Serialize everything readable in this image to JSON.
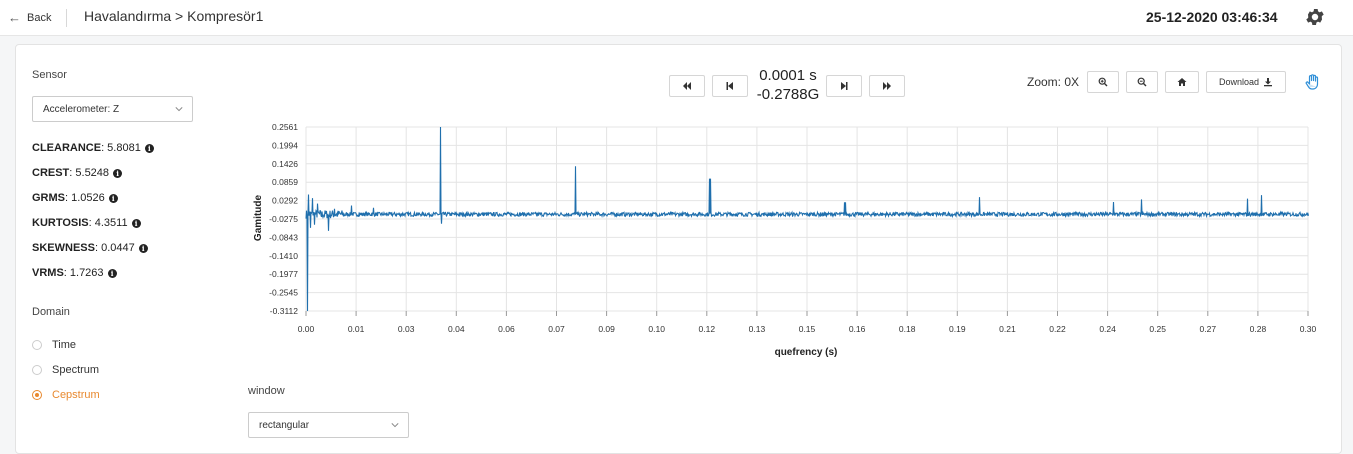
{
  "header": {
    "back_label": "Back",
    "breadcrumb": "Havalandırma > Kompresör1",
    "datetime": "25-12-2020 03:46:34"
  },
  "sidebar": {
    "sensor_label": "Sensor",
    "sensor_value": "Accelerometer: Z",
    "metrics": [
      {
        "name": "CLEARANCE",
        "value": ": 5.8081"
      },
      {
        "name": "CREST",
        "value": ": 5.5248"
      },
      {
        "name": "GRMS",
        "value": ": 1.0526"
      },
      {
        "name": "KURTOSIS",
        "value": ": 4.3511"
      },
      {
        "name": "SKEWNESS",
        "value": ": 0.0447"
      },
      {
        "name": "VRMS",
        "value": ": 1.7263"
      }
    ],
    "domain_label": "Domain",
    "domains": [
      {
        "label": "Time",
        "selected": false
      },
      {
        "label": "Spectrum",
        "selected": false
      },
      {
        "label": "Cepstrum",
        "selected": true
      }
    ]
  },
  "controls": {
    "readout_time": "0.0001 s",
    "readout_value": "-0.2788G",
    "zoom_label": "Zoom: 0X",
    "download_label": "Download"
  },
  "window_select": {
    "label": "window",
    "value": "rectangular"
  },
  "colors": {
    "accent": "#e8892f",
    "series": "#1f6fad",
    "hand_icon": "#2f8fd8"
  },
  "chart_data": {
    "type": "line",
    "xlabel": "quefrency (s)",
    "ylabel": "Gamitude",
    "xlim": [
      0,
      0.3
    ],
    "ylim": [
      -0.3112,
      0.2561
    ],
    "x_ticks": [
      "0.00",
      "0.01",
      "0.03",
      "0.04",
      "0.06",
      "0.07",
      "0.09",
      "0.10",
      "0.12",
      "0.13",
      "0.15",
      "0.16",
      "0.18",
      "0.19",
      "0.21",
      "0.22",
      "0.24",
      "0.25",
      "0.27",
      "0.28",
      "0.30"
    ],
    "y_ticks": [
      "0.2561",
      "0.1994",
      "0.1426",
      "0.0859",
      "0.0292",
      "-0.0275",
      "-0.0843",
      "-0.1410",
      "-0.1977",
      "-0.2545",
      "-0.3112"
    ],
    "grid": true,
    "baseline": -0.013,
    "noise_amplitude": 0.006,
    "peaks": [
      {
        "x": 0.0004,
        "y": -0.3112
      },
      {
        "x": 0.0006,
        "y": 0.048
      },
      {
        "x": 0.0012,
        "y": -0.055
      },
      {
        "x": 0.0018,
        "y": 0.037
      },
      {
        "x": 0.0025,
        "y": -0.045
      },
      {
        "x": 0.0033,
        "y": 0.02
      },
      {
        "x": 0.0045,
        "y": -0.021
      },
      {
        "x": 0.0065,
        "y": -0.064
      },
      {
        "x": 0.0085,
        "y": 0.004
      },
      {
        "x": 0.0134,
        "y": 0.014
      },
      {
        "x": 0.02,
        "y": 0.007
      },
      {
        "x": 0.04,
        "y": 0.2561
      },
      {
        "x": 0.0404,
        "y": -0.042
      },
      {
        "x": 0.0806,
        "y": 0.135
      },
      {
        "x": 0.1208,
        "y": 0.097
      },
      {
        "x": 0.1612,
        "y": 0.024
      },
      {
        "x": 0.2014,
        "y": 0.04
      },
      {
        "x": 0.2417,
        "y": 0.025
      },
      {
        "x": 0.25,
        "y": 0.033
      },
      {
        "x": 0.2818,
        "y": 0.035
      },
      {
        "x": 0.286,
        "y": 0.046
      }
    ]
  }
}
